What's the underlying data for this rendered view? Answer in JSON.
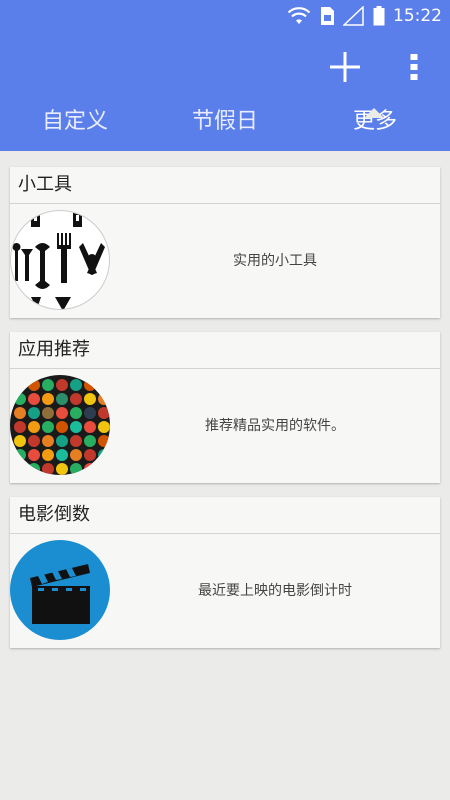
{
  "status_bar": {
    "time": "15:22",
    "icons": [
      "wifi-icon",
      "sim-card-icon",
      "signal-icon",
      "battery-icon"
    ]
  },
  "toolbar": {
    "add_icon": "plus-icon",
    "more_icon": "overflow-menu-icon"
  },
  "tabs": [
    {
      "label": "自定义",
      "active": false
    },
    {
      "label": "节假日",
      "active": false
    },
    {
      "label": "更多",
      "active": true
    }
  ],
  "cards": [
    {
      "title": "小工具",
      "description": "实用的小工具",
      "icon": "tools-icon"
    },
    {
      "title": "应用推荐",
      "description": "推荐精品实用的软件。",
      "icon": "app-grid-icon"
    },
    {
      "title": "电影倒数",
      "description": "最近要上映的电影倒计时",
      "icon": "clapperboard-icon"
    }
  ],
  "colors": {
    "primary": "#5b7fea",
    "background": "#ebebe9",
    "card": "#f7f8f6",
    "movie_icon_bg": "#1a8ed1"
  }
}
